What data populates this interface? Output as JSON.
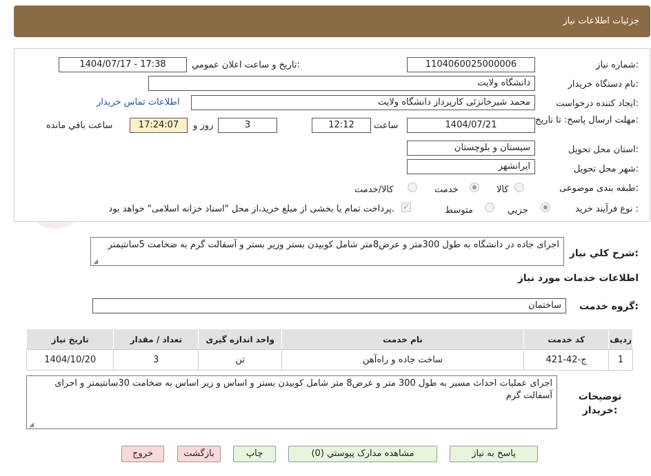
{
  "header": {
    "title": "جزئیات اطلاعات نیاز"
  },
  "form": {
    "need_number_label": "شماره نیاز:",
    "need_number": "1104060025000006",
    "announce_label": "تاریخ و ساعت اعلان عمومي:",
    "announce_value": "1404/07/17 - 17:38",
    "buyer_label": "نام دستگاه خريدار:",
    "buyer_value": "دانشگاه ولايت",
    "creator_label": "ايجاد کننده درخواست:",
    "creator_value": "محمد شيرخانزئی کارپرداز دانشگاه ولايت",
    "contact_link": "اطلاعات تماس خريدار",
    "deadline_label": "مهلت ارسال پاسخ: تا تاريخ:",
    "deadline_date": "1404/07/21",
    "time_label": "ساعت",
    "deadline_time": "12:12",
    "days_value": "3",
    "days_label": "روز و",
    "remaining_time": "17:24:07",
    "remaining_label": "ساعت باقي مانده",
    "province_label": "استان محل تحويل:",
    "province_value": "سيستان و بلوچستان",
    "city_label": "شهر محل تحويل:",
    "city_value": "ايرانشهر",
    "category_label": "طبقه بندی موضوعی:",
    "category_options": [
      "کالا",
      "خدمت",
      "کالا/خدمت"
    ],
    "category_selected": "خدمت",
    "process_label": "نوع فرآيند خريد :",
    "process_options": [
      "جزيي",
      "متوسط"
    ],
    "process_selected": "جزيي",
    "treasury_note": "پرداخت تمام يا بخشی از مبلغ خريد،از محل \"اسناد خزانه اسلامی\" خواهد بود.",
    "treasury_checked": true
  },
  "summary": {
    "label": "شرح کلي نياز:",
    "text": "اجرای جاده در دانشگاه به طول 300متر و عرض8متر شامل کوبيدن بستر وزير بستر و آسفالت گرم به ضخامت 5سانتيمتر"
  },
  "services": {
    "section_title": "اطلاعات خدمات مورد نياز",
    "group_label": "گروه خدمت:",
    "group_value": "ساختمان",
    "columns": [
      "رديف",
      "کد خدمت",
      "نام خدمت",
      "واحد اندازه گيری",
      "تعداد / مقدار",
      "تاريخ نياز"
    ],
    "rows": [
      [
        "1",
        "ج-42-421",
        "ساخت جاده و راه‌آهن",
        "تن",
        "3",
        "1404/10/20"
      ]
    ]
  },
  "buyer_notes": {
    "label": "توضيحات خريدار:",
    "text": "اجرای عمليات احداث مسير به طول 300 متر و عرض8 متر شامل کوبيدن بستر و اساس و زير اساس به ضخامت 30سانتيمتر و اجرای آسفالت گرم"
  },
  "buttons": {
    "reply": "پاسخ به نياز",
    "attachments": "مشاهده مدارک پيوستي (0)",
    "print": "چاپ",
    "back": "بازگشت",
    "exit": "خروج"
  },
  "colors": {
    "header_bg": "#8b6b46",
    "link": "#1a55b8",
    "button_green": "#e6f5dc",
    "button_red": "#fbd9d9",
    "remaining_bg": "#fdf0c8"
  }
}
